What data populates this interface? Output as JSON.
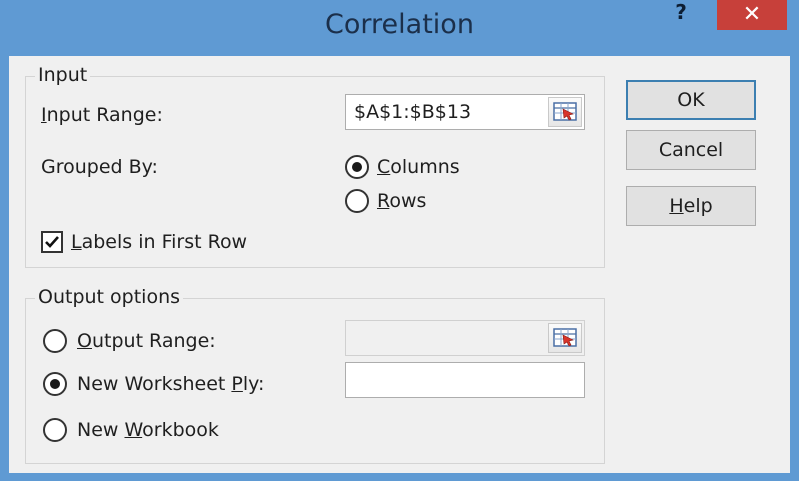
{
  "window": {
    "title": "Correlation",
    "help_glyph": "?",
    "close_glyph": "✕"
  },
  "input": {
    "group_title": "Input",
    "input_range_label_pre": "",
    "input_range_label_u": "I",
    "input_range_label_post": "nput Range:",
    "input_range_value": "$A$1:$B$13",
    "grouped_by_label": "Grouped By:",
    "columns_u": "C",
    "columns_rest": "olumns",
    "rows_u": "R",
    "rows_rest": "ows",
    "grouped_by_selected": "Columns",
    "labels_u": "L",
    "labels_rest": "abels in First Row",
    "labels_checked": true
  },
  "output": {
    "group_title": "Output options",
    "output_range_u": "O",
    "output_range_rest": "utput Range:",
    "output_range_value": "",
    "new_ply_pre": "New Worksheet ",
    "new_ply_u": "P",
    "new_ply_post": "ly:",
    "new_ply_value": "",
    "new_workbook_pre": "New ",
    "new_workbook_u": "W",
    "new_workbook_post": "orkbook",
    "selected": "New Worksheet Ply"
  },
  "buttons": {
    "ok": "OK",
    "cancel": "Cancel",
    "help_u": "H",
    "help_rest": "elp"
  },
  "icons": {
    "range_picker": "collapse-dialog-icon",
    "check": "checkmark-icon"
  }
}
